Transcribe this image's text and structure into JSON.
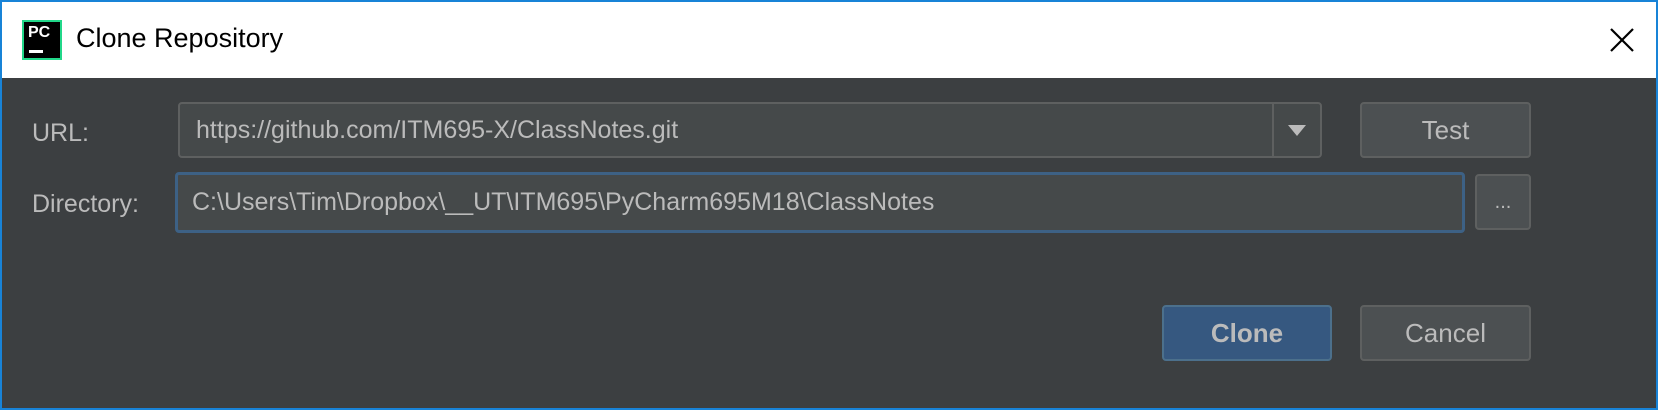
{
  "dialog": {
    "title": "Clone Repository",
    "app_icon_text": "PC"
  },
  "url": {
    "label": "URL:",
    "value": "https://github.com/ITM695-X/ClassNotes.git"
  },
  "directory": {
    "label": "Directory:",
    "value": "C:\\Users\\Tim\\Dropbox\\__UT\\ITM695\\PyCharm695M18\\ClassNotes",
    "browse_label": "..."
  },
  "buttons": {
    "test": "Test",
    "clone": "Clone",
    "cancel": "Cancel"
  },
  "colors": {
    "background": "#3c3f41",
    "primary_button": "#365880",
    "focus_border": "#3d6185",
    "window_border": "#1883d7"
  }
}
